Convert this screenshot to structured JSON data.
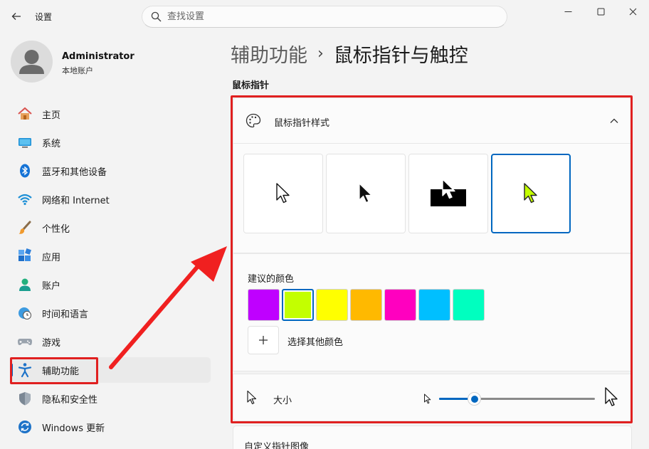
{
  "window": {
    "app_title": "设置",
    "minimize_icon": "minimize-icon",
    "maximize_icon": "maximize-icon",
    "close_icon": "close-icon"
  },
  "search": {
    "placeholder": "查找设置"
  },
  "profile": {
    "name": "Administrator",
    "account_type": "本地账户"
  },
  "nav": {
    "items": [
      {
        "label": "主页",
        "icon": "home-icon"
      },
      {
        "label": "系统",
        "icon": "system-icon"
      },
      {
        "label": "蓝牙和其他设备",
        "icon": "bluetooth-icon"
      },
      {
        "label": "网络和 Internet",
        "icon": "wifi-icon"
      },
      {
        "label": "个性化",
        "icon": "brush-icon"
      },
      {
        "label": "应用",
        "icon": "apps-icon"
      },
      {
        "label": "账户",
        "icon": "account-icon"
      },
      {
        "label": "时间和语言",
        "icon": "clock-globe-icon"
      },
      {
        "label": "游戏",
        "icon": "gamepad-icon"
      },
      {
        "label": "辅助功能",
        "icon": "accessibility-icon",
        "active": true
      },
      {
        "label": "隐私和安全性",
        "icon": "shield-icon"
      },
      {
        "label": "Windows 更新",
        "icon": "update-icon"
      }
    ]
  },
  "breadcrumb": {
    "parent": "辅助功能",
    "separator": "›",
    "current": "鼠标指针与触控"
  },
  "mouse_pointer": {
    "section_label": "鼠标指针",
    "style_card_label": "鼠标指针样式",
    "styles": [
      "white",
      "black",
      "inverted",
      "custom"
    ],
    "selected_style": "custom",
    "suggested_colors_label": "建议的颜色",
    "colors": [
      "#bf00ff",
      "#c3ff00",
      "#ffff00",
      "#ffb900",
      "#ff00bf",
      "#00bfff",
      "#00ffbf"
    ],
    "selected_color": "#c3ff00",
    "choose_other_color_label": "选择其他颜色",
    "size_label": "大小",
    "size_level_fraction": 0.23
  },
  "custom_pointer_label": "自定义指针图像",
  "colors": {
    "accent": "#0067c0",
    "highlight": "#e02020"
  }
}
